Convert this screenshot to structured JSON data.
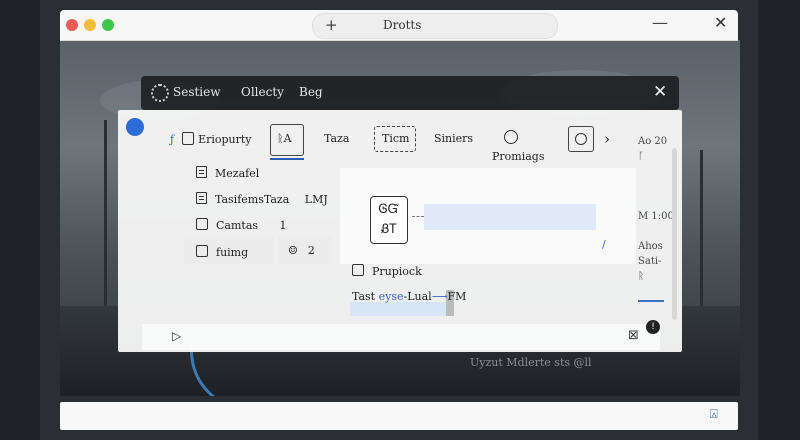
{
  "window": {
    "tab_title": "Drotts",
    "new_tab_glyph": "+",
    "minimize_glyph": "—",
    "close_glyph": "✕"
  },
  "dialog": {
    "menu": [
      "Sestiew",
      "Ollecty",
      "Beg"
    ],
    "close_glyph": "✕"
  },
  "toolbar": {
    "items": [
      {
        "label": "Eriopurty",
        "icon": "edit-icon"
      },
      {
        "label": "ᚱA",
        "icon": "font-icon"
      },
      {
        "label": "Taza"
      },
      {
        "label": "Ticm"
      },
      {
        "label": "Siniers"
      },
      {
        "label": "Promiags",
        "icon": "profile-icon"
      }
    ],
    "chevron_glyph": "›"
  },
  "list": [
    {
      "label": "Mezafel",
      "kind": "doc"
    },
    {
      "label": "TasifemsTaza",
      "value": "LMJ",
      "kind": "doc"
    },
    {
      "label": "Camtas",
      "value": "1",
      "kind": "check"
    },
    {
      "label": "fuimg",
      "kind": "check",
      "badge": "2"
    }
  ],
  "canvas": {
    "glyph_top": "ᎶᏳ",
    "glyph_bottom": "ᏰᎢ"
  },
  "checkbox_label": "Prupiock",
  "path": {
    "prefix": "Tast ",
    "highlight": "eyse",
    "middle": "-Lual",
    "arrow": "⟶",
    "end": "FM"
  },
  "right_panel": {
    "lines": [
      "Ao 20",
      "ᚴ",
      "",
      "",
      "",
      "M 1:00",
      "",
      "Ahos",
      "Sati-",
      "ᚱ"
    ]
  },
  "footer_overlay": "Uyzut Mdlerte sts @ll"
}
